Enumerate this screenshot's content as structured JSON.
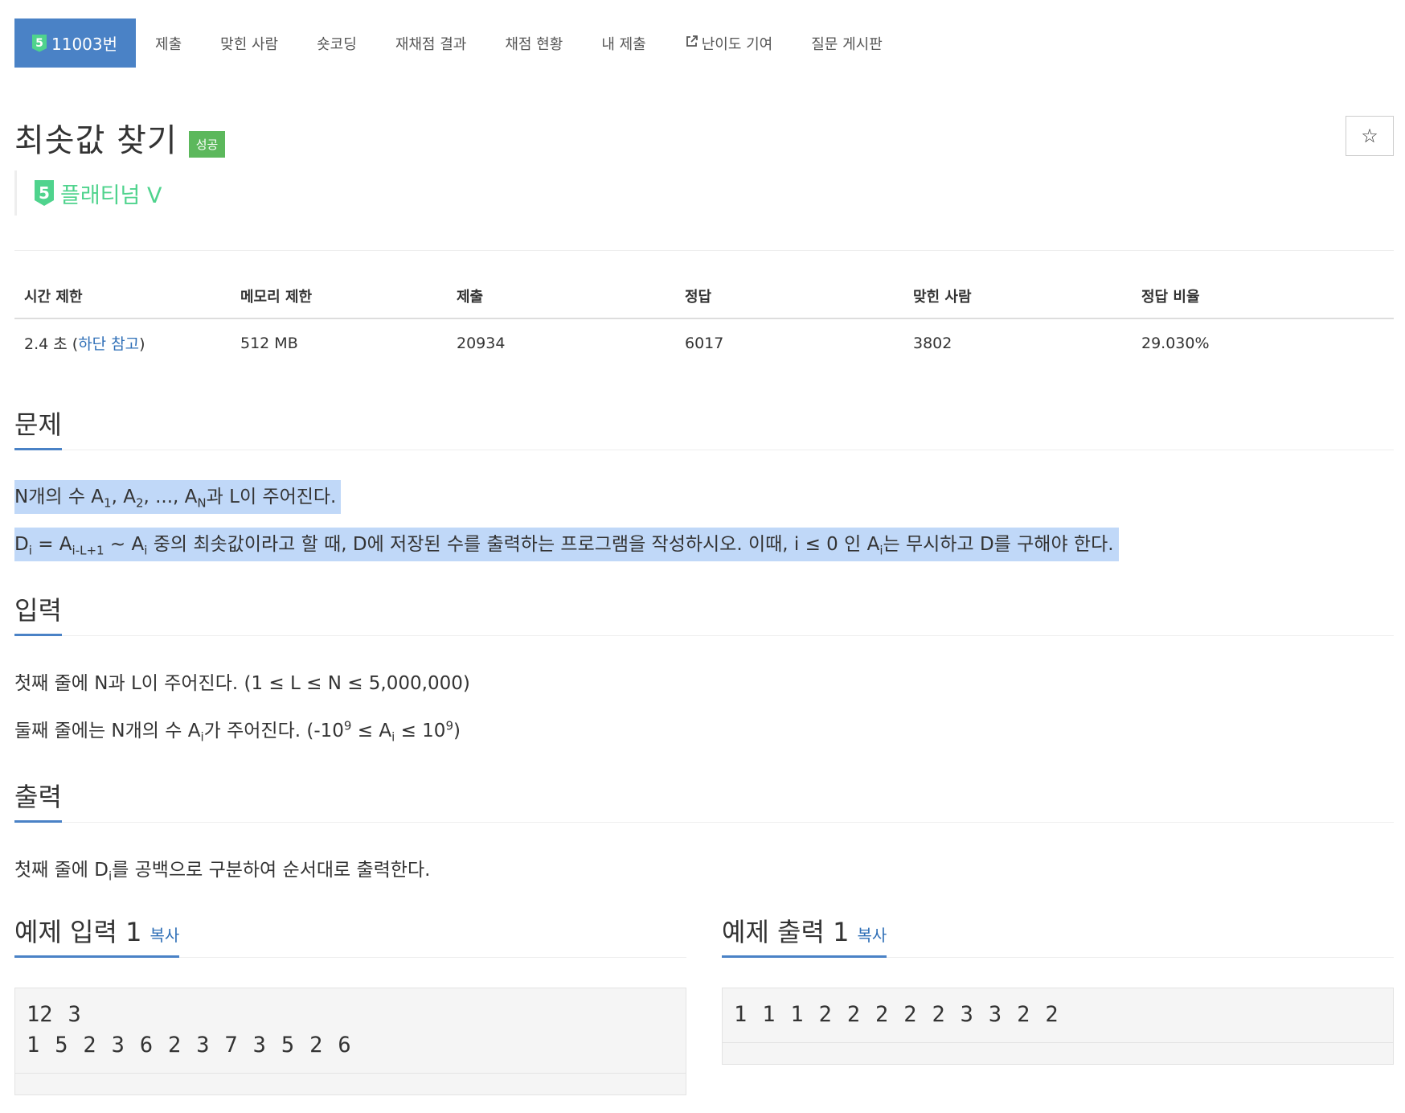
{
  "nav": {
    "problem_tab": {
      "tier_number": "5",
      "label": "11003번"
    },
    "items": [
      "제출",
      "맞힌 사람",
      "숏코딩",
      "재채점 결과",
      "채점 현황",
      "내 제출"
    ],
    "difficulty_contrib": "난이도 기여",
    "qna_board": "질문 게시판"
  },
  "problem": {
    "title": "최솟값 찾기",
    "status_label": "성공",
    "tier_number": "5",
    "tier_name": "플래티넘 V",
    "star_icon": "☆"
  },
  "stats": {
    "headers": [
      "시간 제한",
      "메모리 제한",
      "제출",
      "정답",
      "맞힌 사람",
      "정답 비율"
    ],
    "time_limit": "2.4 초 (",
    "time_link": "하단 참고",
    "time_close": ")",
    "memory": "512 MB",
    "submissions": "20934",
    "accepted": "6017",
    "solvers": "3802",
    "ratio": "29.030%"
  },
  "sections": {
    "description_title": "문제",
    "input_title": "입력",
    "output_title": "출력",
    "sample_input_title": "예제 입력 1",
    "sample_output_title": "예제 출력 1",
    "copy_label": "복사"
  },
  "description": {
    "line1": {
      "a": "N개의 수 A",
      "s1": "1",
      "b": ", A",
      "s2": "2",
      "c": ", ..., A",
      "s3": "N",
      "d": "과 L이 주어진다."
    },
    "line2": {
      "a": "D",
      "s1": "i",
      "b": " = A",
      "s2": "i-L+1",
      "c": " ~ A",
      "s3": "i",
      "d": " 중의 최솟값이라고 할 때, D에 저장된 수를 출력하는 프로그램을 작성하시오. 이때, i ≤ 0 인 A",
      "s4": "i",
      "e": "는 무시하고 D를 구해야 한다."
    }
  },
  "input_desc": {
    "line1": "첫째 줄에 N과 L이 주어진다. (1 ≤ L ≤ N ≤ 5,000,000)",
    "line2": {
      "a": "둘째 줄에는 N개의 수 A",
      "s1": "i",
      "b": "가 주어진다. (-10",
      "p1": "9",
      "c": " ≤ A",
      "s2": "i",
      "d": " ≤ 10",
      "p2": "9",
      "e": ")"
    }
  },
  "output_desc": {
    "a": "첫째 줄에 D",
    "s1": "i",
    "b": "를 공백으로 구분하여 순서대로 출력한다."
  },
  "samples": {
    "input": "12 3\n1 5 2 3 6 2 3 7 3 5 2 6",
    "output": "1 1 1 2 2 2 2 2 3 3 2 2"
  }
}
